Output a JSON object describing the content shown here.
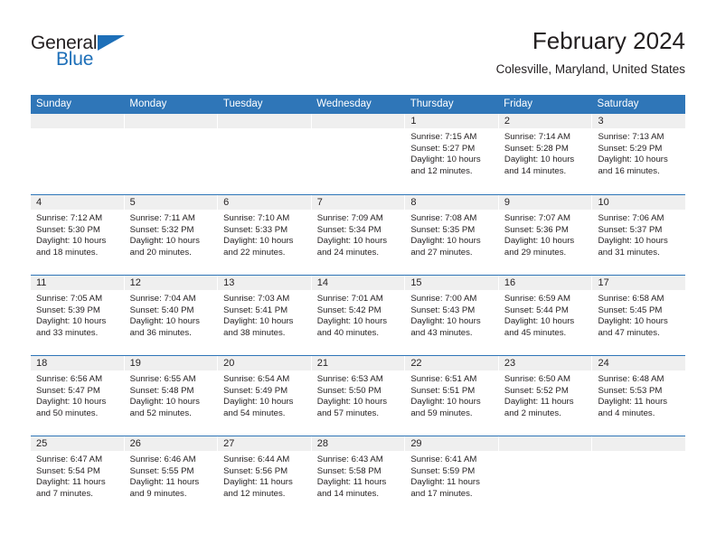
{
  "brand": {
    "name_part1": "General",
    "name_part2": "Blue",
    "accent_color": "#1d6fb8"
  },
  "header": {
    "title": "February 2024",
    "location": "Colesville, Maryland, United States"
  },
  "theme": {
    "header_band": "#2f76b8",
    "day_num_band": "#efefef",
    "text": "#231f20"
  },
  "weekdays": [
    "Sunday",
    "Monday",
    "Tuesday",
    "Wednesday",
    "Thursday",
    "Friday",
    "Saturday"
  ],
  "weeks": [
    [
      {
        "day": "",
        "blank": true
      },
      {
        "day": "",
        "blank": true
      },
      {
        "day": "",
        "blank": true
      },
      {
        "day": "",
        "blank": true
      },
      {
        "day": "1",
        "sunrise": "Sunrise: 7:15 AM",
        "sunset": "Sunset: 5:27 PM",
        "daylight1": "Daylight: 10 hours",
        "daylight2": "and 12 minutes."
      },
      {
        "day": "2",
        "sunrise": "Sunrise: 7:14 AM",
        "sunset": "Sunset: 5:28 PM",
        "daylight1": "Daylight: 10 hours",
        "daylight2": "and 14 minutes."
      },
      {
        "day": "3",
        "sunrise": "Sunrise: 7:13 AM",
        "sunset": "Sunset: 5:29 PM",
        "daylight1": "Daylight: 10 hours",
        "daylight2": "and 16 minutes."
      }
    ],
    [
      {
        "day": "4",
        "sunrise": "Sunrise: 7:12 AM",
        "sunset": "Sunset: 5:30 PM",
        "daylight1": "Daylight: 10 hours",
        "daylight2": "and 18 minutes."
      },
      {
        "day": "5",
        "sunrise": "Sunrise: 7:11 AM",
        "sunset": "Sunset: 5:32 PM",
        "daylight1": "Daylight: 10 hours",
        "daylight2": "and 20 minutes."
      },
      {
        "day": "6",
        "sunrise": "Sunrise: 7:10 AM",
        "sunset": "Sunset: 5:33 PM",
        "daylight1": "Daylight: 10 hours",
        "daylight2": "and 22 minutes."
      },
      {
        "day": "7",
        "sunrise": "Sunrise: 7:09 AM",
        "sunset": "Sunset: 5:34 PM",
        "daylight1": "Daylight: 10 hours",
        "daylight2": "and 24 minutes."
      },
      {
        "day": "8",
        "sunrise": "Sunrise: 7:08 AM",
        "sunset": "Sunset: 5:35 PM",
        "daylight1": "Daylight: 10 hours",
        "daylight2": "and 27 minutes."
      },
      {
        "day": "9",
        "sunrise": "Sunrise: 7:07 AM",
        "sunset": "Sunset: 5:36 PM",
        "daylight1": "Daylight: 10 hours",
        "daylight2": "and 29 minutes."
      },
      {
        "day": "10",
        "sunrise": "Sunrise: 7:06 AM",
        "sunset": "Sunset: 5:37 PM",
        "daylight1": "Daylight: 10 hours",
        "daylight2": "and 31 minutes."
      }
    ],
    [
      {
        "day": "11",
        "sunrise": "Sunrise: 7:05 AM",
        "sunset": "Sunset: 5:39 PM",
        "daylight1": "Daylight: 10 hours",
        "daylight2": "and 33 minutes."
      },
      {
        "day": "12",
        "sunrise": "Sunrise: 7:04 AM",
        "sunset": "Sunset: 5:40 PM",
        "daylight1": "Daylight: 10 hours",
        "daylight2": "and 36 minutes."
      },
      {
        "day": "13",
        "sunrise": "Sunrise: 7:03 AM",
        "sunset": "Sunset: 5:41 PM",
        "daylight1": "Daylight: 10 hours",
        "daylight2": "and 38 minutes."
      },
      {
        "day": "14",
        "sunrise": "Sunrise: 7:01 AM",
        "sunset": "Sunset: 5:42 PM",
        "daylight1": "Daylight: 10 hours",
        "daylight2": "and 40 minutes."
      },
      {
        "day": "15",
        "sunrise": "Sunrise: 7:00 AM",
        "sunset": "Sunset: 5:43 PM",
        "daylight1": "Daylight: 10 hours",
        "daylight2": "and 43 minutes."
      },
      {
        "day": "16",
        "sunrise": "Sunrise: 6:59 AM",
        "sunset": "Sunset: 5:44 PM",
        "daylight1": "Daylight: 10 hours",
        "daylight2": "and 45 minutes."
      },
      {
        "day": "17",
        "sunrise": "Sunrise: 6:58 AM",
        "sunset": "Sunset: 5:45 PM",
        "daylight1": "Daylight: 10 hours",
        "daylight2": "and 47 minutes."
      }
    ],
    [
      {
        "day": "18",
        "sunrise": "Sunrise: 6:56 AM",
        "sunset": "Sunset: 5:47 PM",
        "daylight1": "Daylight: 10 hours",
        "daylight2": "and 50 minutes."
      },
      {
        "day": "19",
        "sunrise": "Sunrise: 6:55 AM",
        "sunset": "Sunset: 5:48 PM",
        "daylight1": "Daylight: 10 hours",
        "daylight2": "and 52 minutes."
      },
      {
        "day": "20",
        "sunrise": "Sunrise: 6:54 AM",
        "sunset": "Sunset: 5:49 PM",
        "daylight1": "Daylight: 10 hours",
        "daylight2": "and 54 minutes."
      },
      {
        "day": "21",
        "sunrise": "Sunrise: 6:53 AM",
        "sunset": "Sunset: 5:50 PM",
        "daylight1": "Daylight: 10 hours",
        "daylight2": "and 57 minutes."
      },
      {
        "day": "22",
        "sunrise": "Sunrise: 6:51 AM",
        "sunset": "Sunset: 5:51 PM",
        "daylight1": "Daylight: 10 hours",
        "daylight2": "and 59 minutes."
      },
      {
        "day": "23",
        "sunrise": "Sunrise: 6:50 AM",
        "sunset": "Sunset: 5:52 PM",
        "daylight1": "Daylight: 11 hours",
        "daylight2": "and 2 minutes."
      },
      {
        "day": "24",
        "sunrise": "Sunrise: 6:48 AM",
        "sunset": "Sunset: 5:53 PM",
        "daylight1": "Daylight: 11 hours",
        "daylight2": "and 4 minutes."
      }
    ],
    [
      {
        "day": "25",
        "sunrise": "Sunrise: 6:47 AM",
        "sunset": "Sunset: 5:54 PM",
        "daylight1": "Daylight: 11 hours",
        "daylight2": "and 7 minutes."
      },
      {
        "day": "26",
        "sunrise": "Sunrise: 6:46 AM",
        "sunset": "Sunset: 5:55 PM",
        "daylight1": "Daylight: 11 hours",
        "daylight2": "and 9 minutes."
      },
      {
        "day": "27",
        "sunrise": "Sunrise: 6:44 AM",
        "sunset": "Sunset: 5:56 PM",
        "daylight1": "Daylight: 11 hours",
        "daylight2": "and 12 minutes."
      },
      {
        "day": "28",
        "sunrise": "Sunrise: 6:43 AM",
        "sunset": "Sunset: 5:58 PM",
        "daylight1": "Daylight: 11 hours",
        "daylight2": "and 14 minutes."
      },
      {
        "day": "29",
        "sunrise": "Sunrise: 6:41 AM",
        "sunset": "Sunset: 5:59 PM",
        "daylight1": "Daylight: 11 hours",
        "daylight2": "and 17 minutes."
      },
      {
        "day": "",
        "blank": true
      },
      {
        "day": "",
        "blank": true
      }
    ]
  ]
}
